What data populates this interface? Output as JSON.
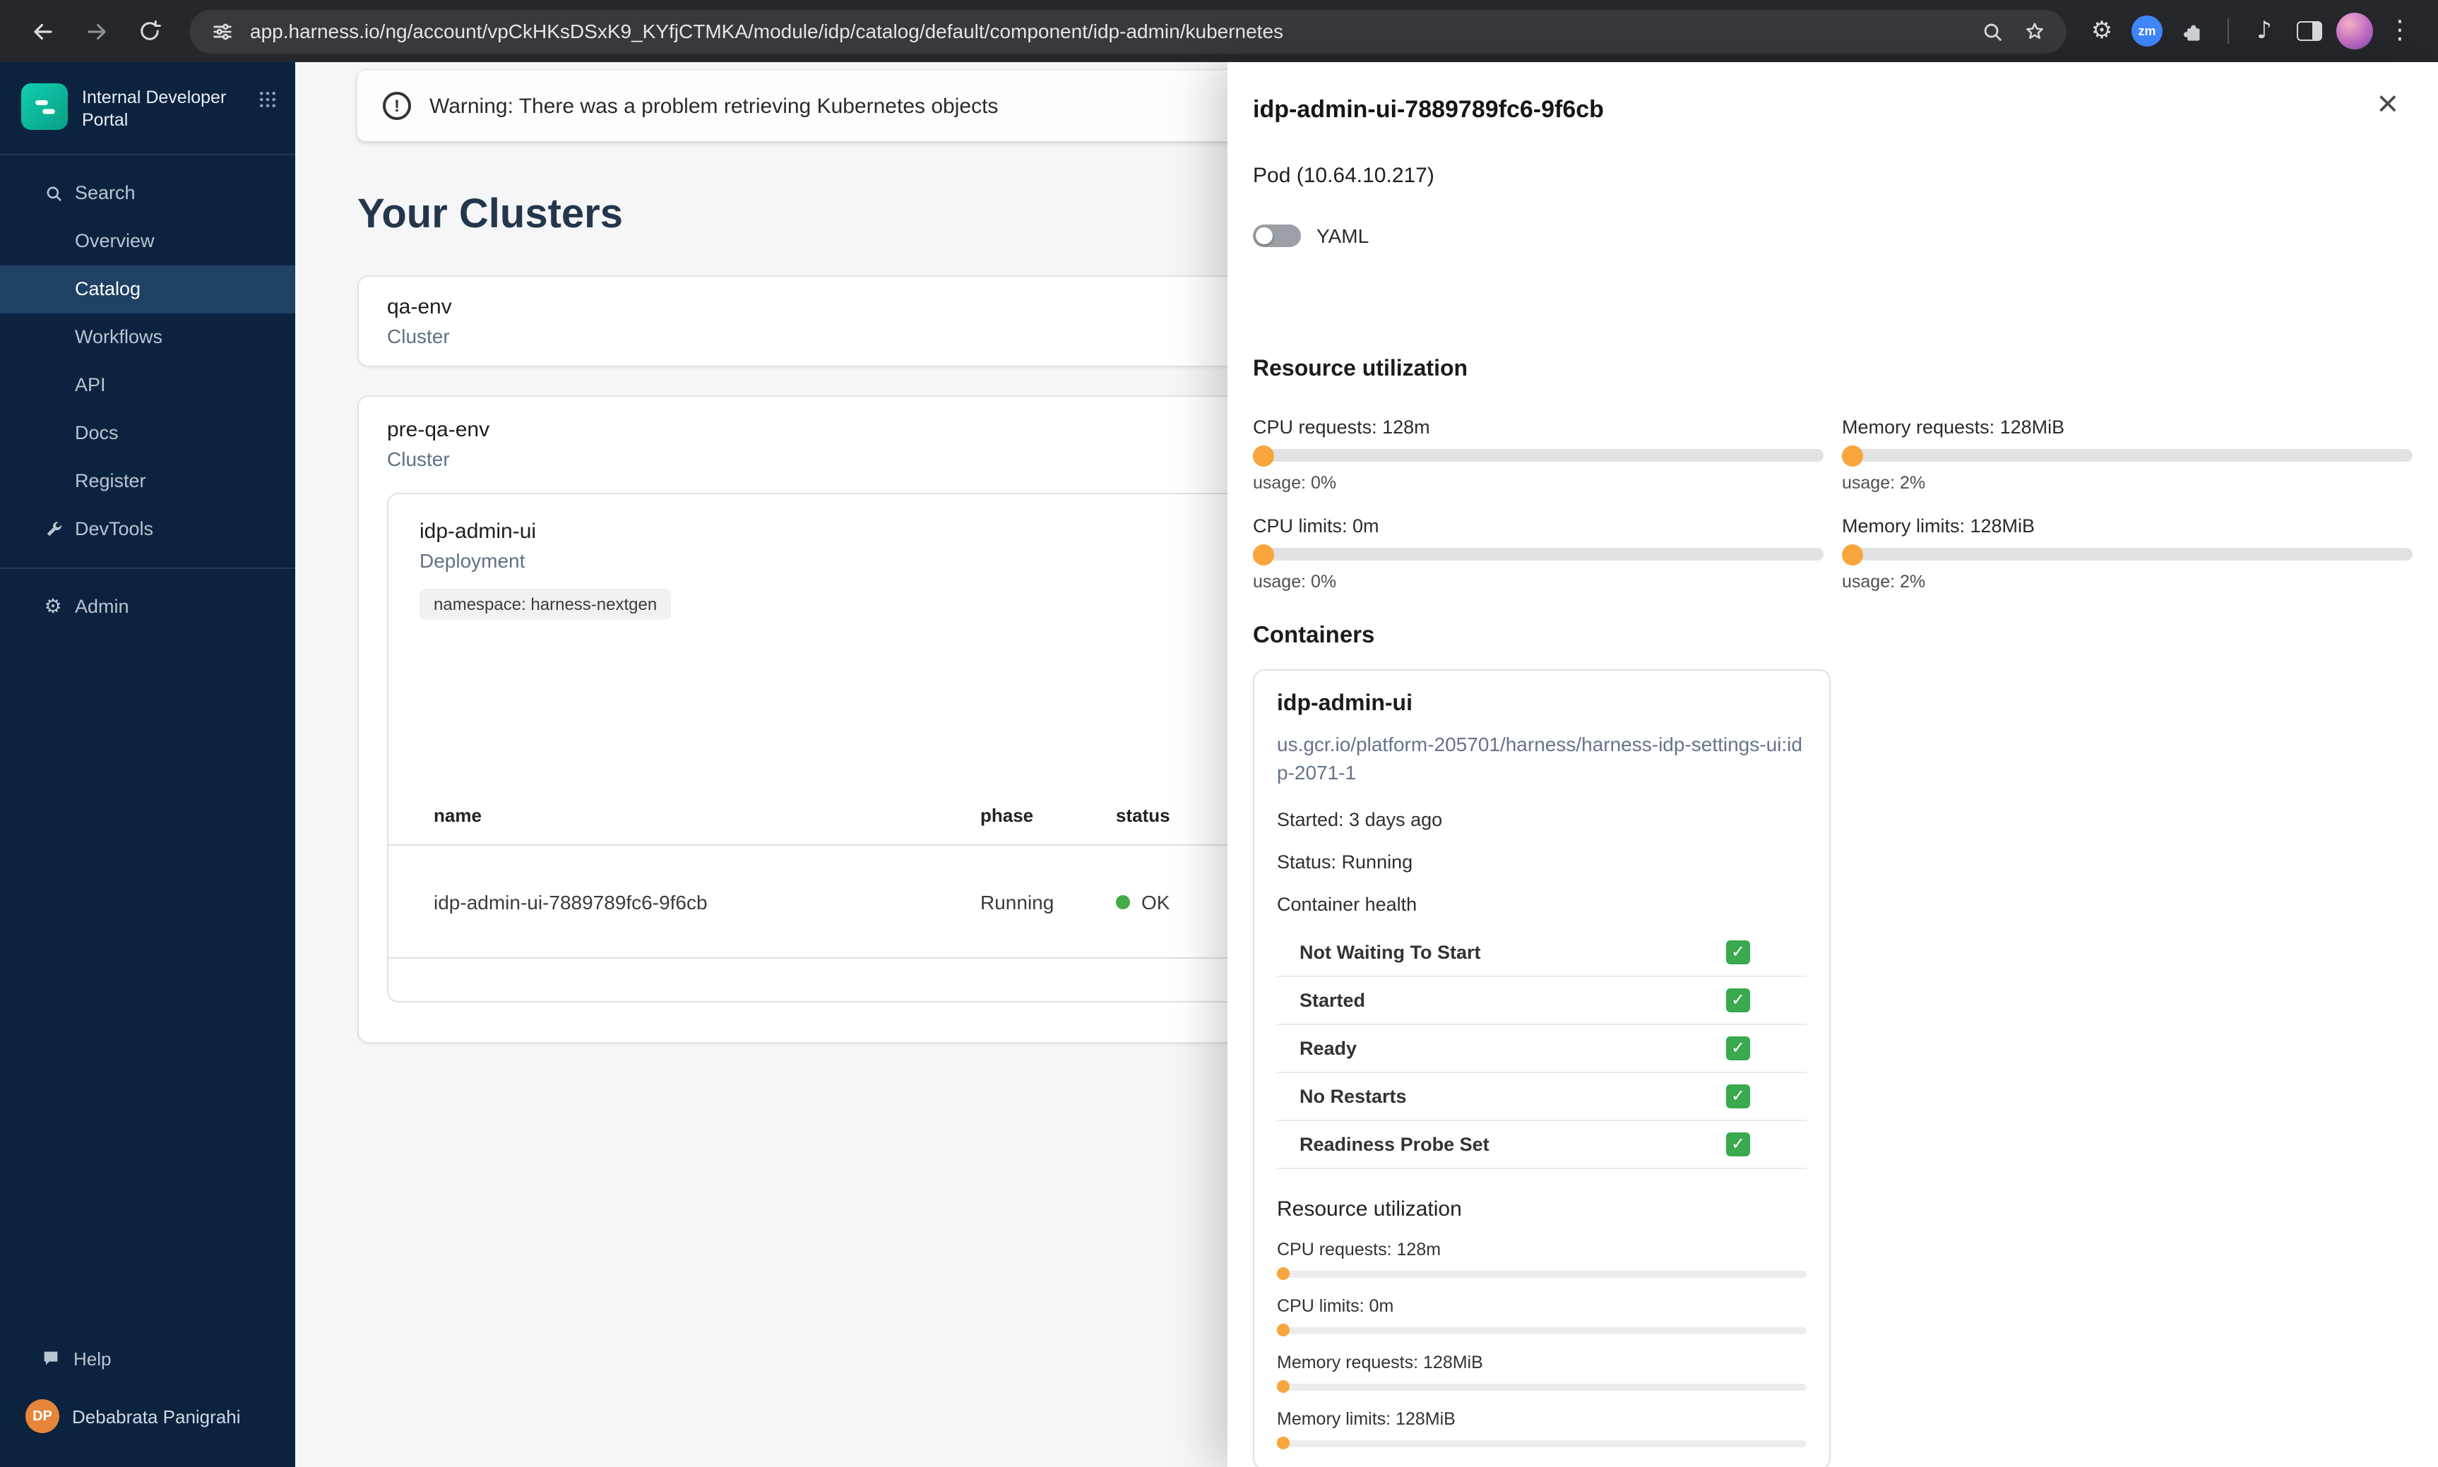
{
  "browser": {
    "url": "app.harness.io/ng/account/vpCkHKsDSxK9_KYfjCTMKA/module/idp/catalog/default/component/idp-admin/kubernetes",
    "zoom_badge": "zm"
  },
  "colors": {
    "accent_orange": "#f7a53c",
    "status_green": "#42ab45",
    "sidebar_navy": "#0c2340",
    "active_item": "#1e4164"
  },
  "sidebar": {
    "logo_title": "Internal Developer Portal",
    "items": [
      {
        "label": "Search",
        "icon": "search-icon"
      },
      {
        "label": "Overview"
      },
      {
        "label": "Catalog",
        "active": true
      },
      {
        "label": "Workflows"
      },
      {
        "label": "API"
      },
      {
        "label": "Docs"
      },
      {
        "label": "Register"
      },
      {
        "label": "DevTools",
        "icon": "wrench-icon"
      },
      {
        "label": "Admin",
        "icon": "gear-icon"
      }
    ],
    "help_label": "Help",
    "user": {
      "initials": "DP",
      "name": "Debabrata Panigrahi"
    }
  },
  "main": {
    "warning": "Warning: There was a problem retrieving Kubernetes objects",
    "title": "Your Clusters",
    "clusters": [
      {
        "name": "qa-env",
        "type": "Cluster"
      },
      {
        "name": "pre-qa-env",
        "type": "Cluster"
      }
    ],
    "deployment": {
      "name": "idp-admin-ui",
      "type": "Deployment",
      "namespace_label": "namespace: harness-nextgen"
    },
    "table": {
      "columns": [
        "name",
        "phase",
        "status"
      ],
      "rows": [
        {
          "name": "idp-admin-ui-7889789fc6-9f6cb",
          "phase": "Running",
          "status": "OK"
        }
      ]
    }
  },
  "drawer": {
    "title": "idp-admin-ui-7889789fc6-9f6cb",
    "subtitle": "Pod (10.64.10.217)",
    "yaml_toggle": {
      "label": "YAML",
      "on": false
    },
    "resource_utilization": {
      "heading": "Resource utilization",
      "metrics": [
        {
          "label": "CPU requests: 128m",
          "usage": "usage: 0%",
          "percent": 0
        },
        {
          "label": "Memory requests: 128MiB",
          "usage": "usage: 2%",
          "percent": 2
        },
        {
          "label": "CPU limits: 0m",
          "usage": "usage: 0%",
          "percent": 0
        },
        {
          "label": "Memory limits: 128MiB",
          "usage": "usage: 2%",
          "percent": 2
        }
      ]
    },
    "containers": {
      "heading": "Containers",
      "container": {
        "name": "idp-admin-ui",
        "image": "us.gcr.io/platform-205701/harness/harness-idp-settings-ui:idp-2071-1",
        "started": "Started: 3 days ago",
        "status": "Status: Running",
        "health_heading": "Container health",
        "checks": [
          "Not Waiting To Start",
          "Started",
          "Ready",
          "No Restarts",
          "Readiness Probe Set"
        ],
        "resource_heading": "Resource utilization",
        "metrics": [
          "CPU requests: 128m",
          "CPU limits: 0m",
          "Memory requests: 128MiB",
          "Memory limits: 128MiB"
        ]
      }
    }
  }
}
